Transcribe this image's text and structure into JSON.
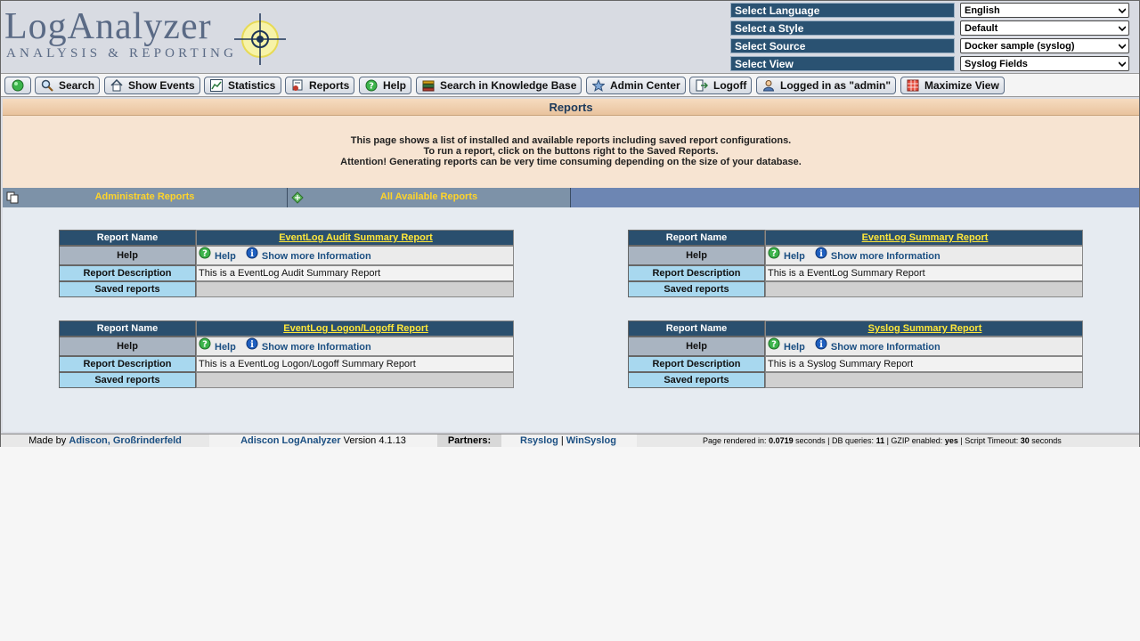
{
  "logo": {
    "main": "LogAnalyzer",
    "sub": "ANALYSIS & REPORTING"
  },
  "selectors": [
    {
      "label": "Select Language",
      "value": "English"
    },
    {
      "label": "Select a Style",
      "value": "Default"
    },
    {
      "label": "Select Source",
      "value": "Docker sample (syslog)"
    },
    {
      "label": "Select View",
      "value": "Syslog Fields"
    }
  ],
  "menu": {
    "search": "Search",
    "show_events": "Show Events",
    "statistics": "Statistics",
    "reports": "Reports",
    "help": "Help",
    "knowledge": "Search in Knowledge Base",
    "admin": "Admin Center",
    "logoff": "Logoff",
    "logged_in": "Logged in as \"admin\"",
    "maximize": "Maximize View"
  },
  "page": {
    "title": "Reports",
    "info_1": "This page shows a list of installed and available reports including saved report configurations.",
    "info_2": "To run a report, click on the buttons right to the Saved Reports.",
    "info_3": "Attention! Generating reports can be very time consuming depending on the size of your database."
  },
  "tabs": {
    "administrate": "Administrate Reports",
    "available": "All Available Reports"
  },
  "labels": {
    "report_name": "Report Name",
    "help": "Help",
    "report_description": "Report Description",
    "saved_reports": "Saved reports",
    "help_link": "Help",
    "more_info": "Show more Information"
  },
  "reports": [
    {
      "name": "EventLog Audit Summary Report",
      "description": "This is a EventLog Audit Summary Report"
    },
    {
      "name": "EventLog Summary Report",
      "description": "This is a EventLog Summary Report"
    },
    {
      "name": "EventLog Logon/Logoff Report",
      "description": "This is a EventLog Logon/Logoff Summary Report"
    },
    {
      "name": "Syslog Summary Report",
      "description": "This is a Syslog Summary Report"
    }
  ],
  "footer": {
    "made_by": "Made by",
    "author": "Adiscon, Großrinderfeld",
    "product": "Adiscon LogAnalyzer",
    "version": "Version 4.1.13",
    "partners": "Partners:",
    "partner_1": "Rsyslog",
    "sep": "|",
    "partner_2": "WinSyslog",
    "stats_prefix": "Page rendered in:",
    "render_time": "0.0719",
    "seconds": "seconds",
    "db_label": "| DB queries:",
    "db_queries": "11",
    "gzip_label": "| GZIP enabled:",
    "gzip": "yes",
    "timeout_label": "| Script Timeout:",
    "timeout": "30",
    "seconds_2": "seconds"
  },
  "colors": {
    "accent": "#2a4f6e",
    "link_yellow": "#ffe73a",
    "title_bg": "#f6dcc0"
  }
}
